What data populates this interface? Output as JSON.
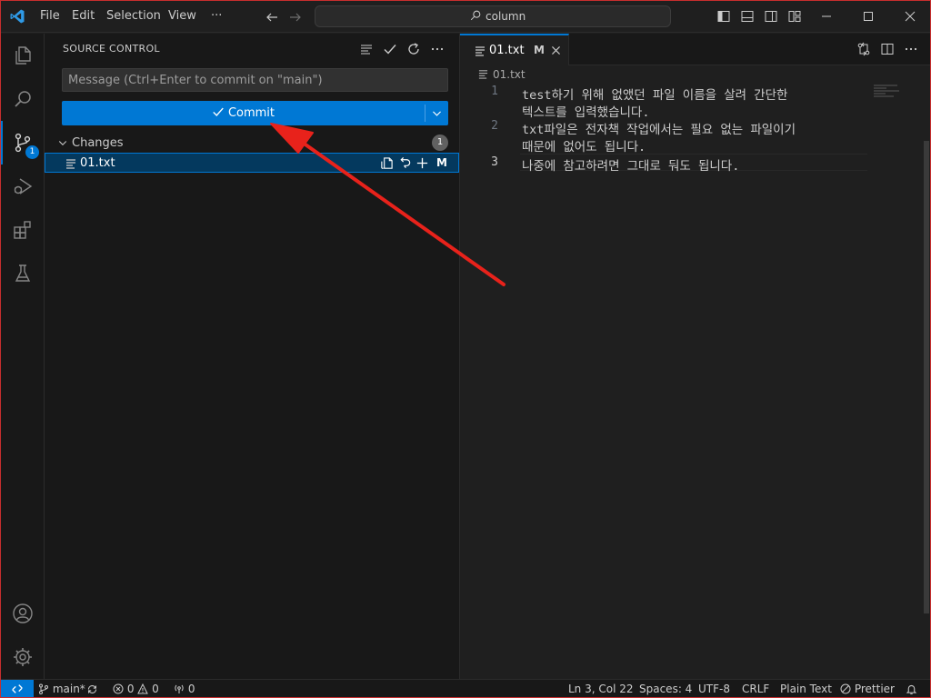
{
  "window": {
    "border_color": "#c72e2e",
    "accent": "#0078d4"
  },
  "menu": {
    "items": [
      "File",
      "Edit",
      "Selection",
      "View",
      "···"
    ]
  },
  "command_center": {
    "text": "column"
  },
  "activity_bar": {
    "items": [
      {
        "name": "explorer",
        "icon": "files-icon"
      },
      {
        "name": "search",
        "icon": "search-icon"
      },
      {
        "name": "source-control",
        "icon": "source-control-icon",
        "badge": "1",
        "active": true
      },
      {
        "name": "run-debug",
        "icon": "run-debug-icon"
      },
      {
        "name": "extensions",
        "icon": "extensions-icon"
      },
      {
        "name": "testing",
        "icon": "beaker-icon"
      }
    ],
    "bottom": [
      {
        "name": "accounts",
        "icon": "account-icon"
      },
      {
        "name": "manage",
        "icon": "gear-icon"
      }
    ]
  },
  "sidebar": {
    "title": "SOURCE CONTROL",
    "message_placeholder": "Message (Ctrl+Enter to commit on \"main\")",
    "commit_label": "Commit",
    "changes_label": "Changes",
    "changes_count": "1",
    "files": [
      {
        "name": "01.txt",
        "status": "M"
      }
    ]
  },
  "editor": {
    "tab": {
      "name": "01.txt",
      "status": "M"
    },
    "breadcrumb": "01.txt",
    "lines": [
      {
        "number": "1",
        "text": "test하기 위해 없앴던 파일 이름을 살려 간단한"
      },
      {
        "number": "",
        "text": "텍스트를 입력했습니다."
      },
      {
        "number": "2",
        "text": "txt파일은 전자책 작업에서는 필요 없는 파일이기"
      },
      {
        "number": "",
        "text": "때문에 없어도 됩니다."
      },
      {
        "number": "3",
        "text": "나중에 참고하려면 그대로 둬도 됩니다."
      }
    ]
  },
  "statusbar": {
    "branch": "main*",
    "errors": "0",
    "warnings": "0",
    "ports": "0",
    "position": "Ln 3, Col 22",
    "spaces": "Spaces: 4",
    "encoding": "UTF-8",
    "eol": "CRLF",
    "language": "Plain Text",
    "formatter": "Prettier"
  },
  "annotation": {
    "color": "#e8221b"
  }
}
